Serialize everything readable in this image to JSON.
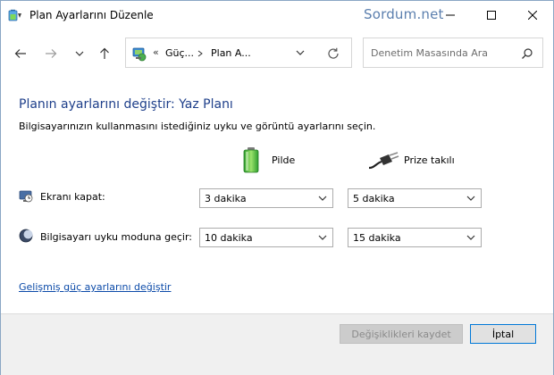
{
  "window": {
    "title": "Plan Ayarlarını Düzenle",
    "watermark": "Sordum.net"
  },
  "toolbar": {
    "breadcrumb": {
      "overflow": "«",
      "segments": [
        "Güç...",
        "Plan A..."
      ]
    },
    "search": {
      "placeholder": "Denetim Masasında Ara"
    }
  },
  "content": {
    "heading": "Planın ayarlarını değiştir: Yaz Planı",
    "subtitle": "Bilgisayarınızın kullanmasını istediğiniz uyku ve görüntü ayarlarını seçin.",
    "columns": {
      "battery": "Pilde",
      "plugged": "Prize takılı"
    },
    "rows": [
      {
        "label": "Ekranı kapat:",
        "icon": "display-off-icon",
        "battery_value": "3 dakika",
        "plugged_value": "5 dakika"
      },
      {
        "label": "Bilgisayarı uyku moduna geçir:",
        "icon": "sleep-moon-icon",
        "battery_value": "10 dakika",
        "plugged_value": "15 dakika"
      }
    ],
    "advanced_link": "Gelişmiş güç ayarlarını değiştir"
  },
  "footer": {
    "save_label": "Değişiklikleri kaydet",
    "cancel_label": "İptal"
  },
  "colors": {
    "heading": "#1e3f8a",
    "link": "#0b4aa8",
    "watermark": "#5b7fae",
    "focus_border": "#0078d7"
  }
}
